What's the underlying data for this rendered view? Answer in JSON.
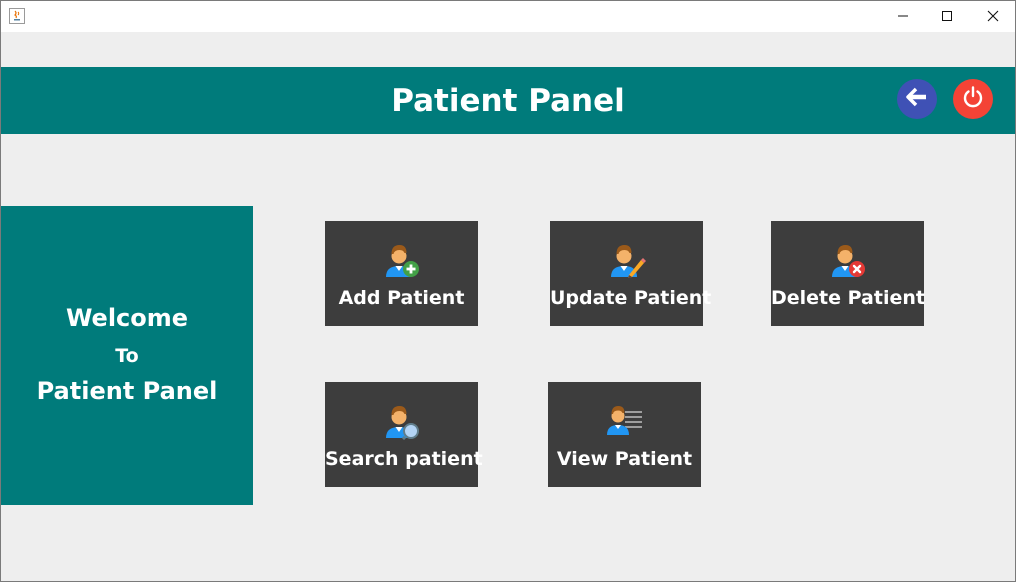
{
  "window": {
    "app_icon": "java-icon",
    "controls": {
      "minimize_icon": "minimize-icon",
      "maximize_icon": "maximize-icon",
      "close_icon": "close-icon"
    }
  },
  "header": {
    "title": "Patient Panel",
    "back_icon": "arrow-left-icon",
    "power_icon": "power-icon",
    "colors": {
      "bar": "#007b7b",
      "back": "#3f51b5",
      "power": "#f44336"
    }
  },
  "welcome": {
    "line1": "Welcome",
    "line2": "To",
    "line3": "Patient Panel"
  },
  "actions": [
    {
      "label": "Add Patient",
      "icon": "add-user-icon"
    },
    {
      "label": "Update Patient",
      "icon": "edit-user-icon"
    },
    {
      "label": "Delete Patient",
      "icon": "remove-user-icon"
    },
    {
      "label": "Search patient",
      "icon": "search-user-icon"
    },
    {
      "label": "View Patient",
      "icon": "view-user-icon"
    }
  ],
  "colors": {
    "tile": "#3d3d3d",
    "background": "#eeeeee",
    "accent": "#007b7b"
  }
}
